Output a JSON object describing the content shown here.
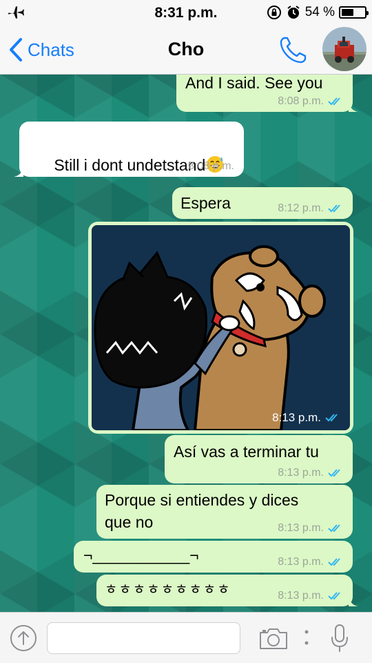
{
  "status_bar": {
    "time": "8:31 p.m.",
    "battery_text": "54 %",
    "battery_level": 0.54,
    "icons": [
      "airplane-icon",
      "orientation-lock-icon",
      "alarm-icon",
      "battery-icon"
    ]
  },
  "header": {
    "back_label": "Chats",
    "title": "Cho",
    "call_icon": "phone-icon",
    "accent_color": "#157efb"
  },
  "messages": [
    {
      "direction": "out",
      "text": "And I said. See you",
      "time": "8:08 p.m.",
      "read": true
    },
    {
      "direction": "in",
      "text": "Still i dont undetstand",
      "emoji": "sweat-smile-emoji",
      "time": "8:08 p.m."
    },
    {
      "direction": "out",
      "text": "Espera",
      "time": "8:12 p.m.",
      "read": true
    },
    {
      "direction": "out",
      "type": "image",
      "time": "8:13 p.m.",
      "read": true
    },
    {
      "direction": "out",
      "text": "Así vas a terminar tu",
      "time": "8:13 p.m.",
      "read": true
    },
    {
      "direction": "out",
      "text": "Porque si entiendes y dices\nque no",
      "time": "8:13 p.m.",
      "read": true
    },
    {
      "direction": "out",
      "text": "¬___________¬",
      "time": "8:13 p.m.",
      "read": true
    },
    {
      "direction": "out",
      "text": "ㅎㅎㅎㅎㅎㅎㅎㅎㅎ",
      "time": "8:13 p.m.",
      "read": true
    }
  ],
  "input_bar": {
    "placeholder": "",
    "icons": [
      "upload-icon",
      "camera-icon",
      "more-icon",
      "microphone-icon"
    ]
  },
  "colors": {
    "outgoing_bubble": "#dcf8c6",
    "incoming_bubble": "#ffffff",
    "read_ticks": "#34b7f1",
    "wallpaper": "#1d8c79"
  }
}
